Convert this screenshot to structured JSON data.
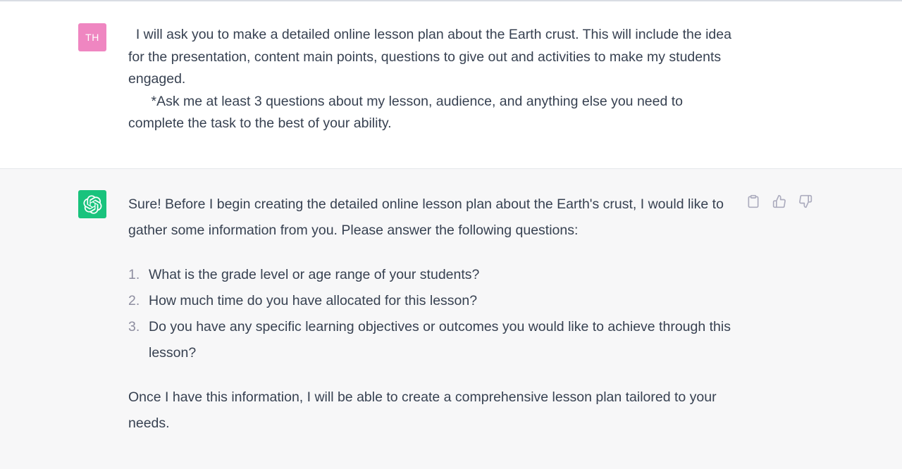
{
  "user_message": {
    "avatar_initials": "TH",
    "avatar_color": "#ef86c1",
    "text": "  I will ask you to make a detailed online lesson plan about the Earth crust. This will include the idea for the presentation, content main points, questions to give out and activities to make my students engaged.\n      *Ask me at least 3 questions about my lesson, audience, and anything else you need to complete the task to the best of your ability."
  },
  "assistant_message": {
    "avatar_color": "#19c37d",
    "avatar_icon": "openai-logo-icon",
    "intro": "Sure! Before I begin creating the detailed online lesson plan about the Earth's crust, I would like to gather some information from you. Please answer the following questions:",
    "questions": [
      {
        "num": "1.",
        "text": "What is the grade level or age range of your students?"
      },
      {
        "num": "2.",
        "text": "How much time do you have allocated for this lesson?"
      },
      {
        "num": "3.",
        "text": "Do you have any specific learning objectives or outcomes you would like to achieve through this lesson?"
      }
    ],
    "outro": "Once I have this information, I will be able to create a comprehensive lesson plan tailored to your needs.",
    "actions": [
      "copy-icon",
      "thumbs-up-icon",
      "thumbs-down-icon"
    ]
  }
}
